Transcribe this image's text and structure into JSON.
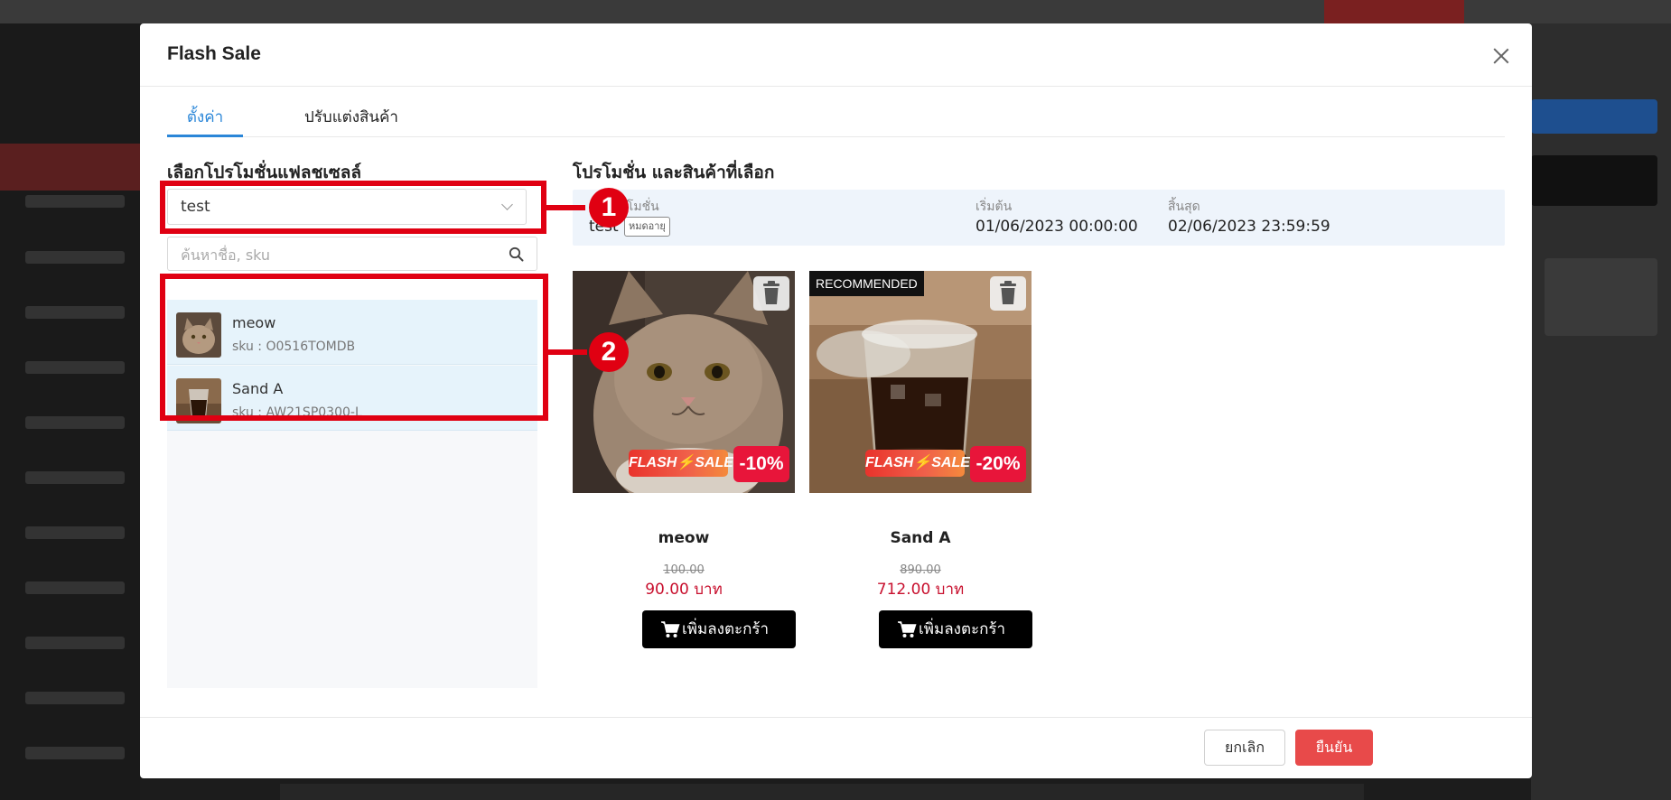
{
  "modal": {
    "title": "Flash Sale",
    "tabs": [
      {
        "label": "ตั้งค่า",
        "active": true
      },
      {
        "label": "ปรับแต่งสินค้า",
        "active": false
      }
    ]
  },
  "left_panel": {
    "title": "เลือกโปรโมชั่นแฟลชเซลล์",
    "select_value": "test",
    "search_placeholder": "ค้นหาชื่อ, sku",
    "items": [
      {
        "name": "meow",
        "sku": "sku : O0516TOMDB"
      },
      {
        "name": "Sand A",
        "sku": "sku : AW21SP0300-L"
      }
    ]
  },
  "right_panel": {
    "title": "โปรโมชั่น และสินค้าที่เลือก",
    "promo": {
      "name_label": "ชื่อโปรโมชั่น",
      "name": "test",
      "status": "หมดอายุ",
      "start_label": "เริ่มต้น",
      "start": "01/06/2023 00:00:00",
      "end_label": "สิ้นสุด",
      "end": "02/06/2023 23:59:59"
    },
    "products": [
      {
        "name": "meow",
        "old_price": "100.00",
        "price": "90.00 บาท",
        "discount": "-10%",
        "flash_label": "FLASH⚡SALE",
        "recommended": "",
        "cart_label": "เพิ่มลงตะกร้า"
      },
      {
        "name": "Sand A",
        "old_price": "890.00",
        "price": "712.00 บาท",
        "discount": "-20%",
        "flash_label": "FLASH⚡SALE",
        "recommended": "RECOMMENDED",
        "cart_label": "เพิ่มลงตะกร้า"
      }
    ]
  },
  "footer": {
    "cancel": "ยกเลิก",
    "confirm": "ยืนยัน"
  },
  "annotations": [
    "1",
    "2"
  ],
  "colors": {
    "accent_blue": "#2a86d8",
    "annotation_red": "#e00012",
    "price_red": "#c8102e",
    "confirm_red": "#e84a4a",
    "discount_red": "#e8153a"
  }
}
